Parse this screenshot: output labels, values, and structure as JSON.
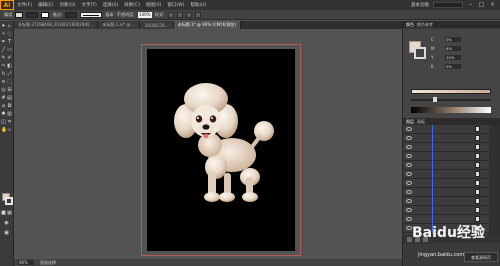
{
  "menubar": {
    "logo": "Ai",
    "items": [
      "文件(F)",
      "编辑(E)",
      "对象(O)",
      "文字(T)",
      "选择(S)",
      "效果(C)",
      "视图(V)",
      "窗口(W)",
      "帮助(H)"
    ],
    "workspace": "基本功能"
  },
  "controlbar": {
    "selection_label": "编组",
    "stroke_label": "描边:",
    "stroke_style": "基本",
    "opacity_label": "不透明度:",
    "opacity_value": "100%",
    "style_label": "样式:"
  },
  "tabs": [
    "未标题-27298468_20180216002940...",
    "未标题-1.ai* @ ...",
    "20180216...",
    "未标题-1* @ 96% (CMYK/预览)"
  ],
  "status": {
    "zoom": "96%",
    "tool": "直接选择"
  },
  "color_panel": {
    "tabs": [
      "颜色",
      "颜色参考"
    ],
    "rows": [
      {
        "label": "C",
        "value": "0%"
      },
      {
        "label": "M",
        "value": "8%"
      },
      {
        "label": "Y",
        "value": "15%"
      },
      {
        "label": "K",
        "value": "0%"
      }
    ]
  },
  "layers_panel": {
    "tabs": [
      "图层",
      "画板"
    ],
    "row_count": 12
  },
  "watermark": {
    "text": "Baidu经验",
    "url": "jingyan.baidu.com",
    "badge": "查看源网页"
  },
  "colors": {
    "fill": "#e8d8c8",
    "artboard": "#000000",
    "accent": "#ff9a00"
  }
}
